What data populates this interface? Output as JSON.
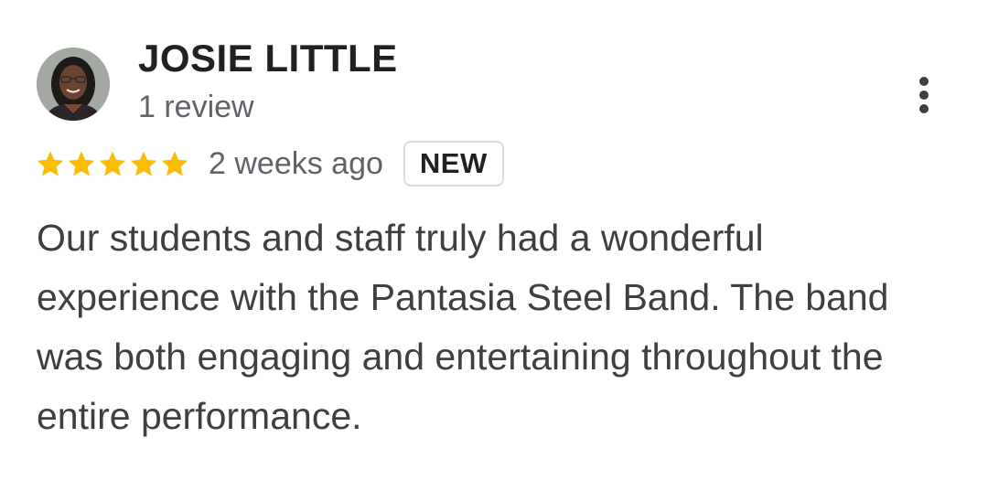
{
  "review": {
    "reviewer_name": "JOSIE LITTLE",
    "review_count": "1 review",
    "rating": 5,
    "rating_max": 5,
    "date": "2 weeks ago",
    "badge": "NEW",
    "text": "Our students and staff truly had a wonderful experience with the Pantasia Steel Band. The band was both engaging and entertaining throughout the entire performance."
  },
  "icons": {
    "avatar": "reviewer-photo",
    "star": "star-icon",
    "more": "more-vert-icon"
  },
  "colors": {
    "star": "#fbbc04",
    "name": "#202124",
    "secondary_text": "#5f6368",
    "body_text": "#3c4043",
    "badge_border": "#dadce0"
  }
}
